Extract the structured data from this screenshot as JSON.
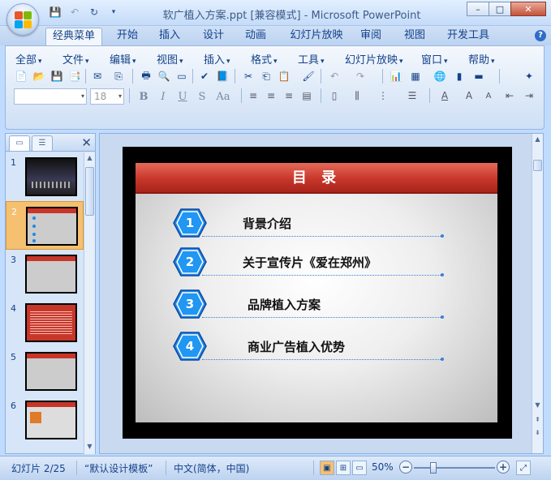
{
  "window": {
    "title": "软广植入方案.ppt [兼容模式] - Microsoft PowerPoint",
    "min": "–",
    "max": "□",
    "close": "✕"
  },
  "ribbon_tabs": [
    "经典菜单",
    "开始",
    "插入",
    "设计",
    "动画",
    "幻灯片放映",
    "审阅",
    "视图",
    "开发工具"
  ],
  "menus": [
    "全部",
    "文件",
    "编辑",
    "视图",
    "插入",
    "格式",
    "工具",
    "幻灯片放映",
    "窗口",
    "帮助"
  ],
  "font": {
    "name_placeholder": "",
    "size": "18"
  },
  "format_buttons": [
    "B",
    "I",
    "U",
    "S",
    "Aa"
  ],
  "slides_pane": {
    "numbers": [
      "1",
      "2",
      "3",
      "4",
      "5",
      "6"
    ],
    "selected_index": 1
  },
  "slide": {
    "title": "目 录",
    "items": [
      {
        "num": "1",
        "label": "背景介绍"
      },
      {
        "num": "2",
        "label": "关于宣传片《爱在郑州》"
      },
      {
        "num": "3",
        "label": "品牌植入方案"
      },
      {
        "num": "4",
        "label": "商业广告植入优势"
      }
    ]
  },
  "status": {
    "slide_info": "幻灯片 2/25",
    "template": "“默认设计模板”",
    "language": "中文(简体，中国)",
    "zoom": "50%"
  },
  "colors": {
    "accent_red": "#c8362a",
    "hex_blue": "#1e88e5",
    "ribbon_blue": "#bfdbff"
  }
}
